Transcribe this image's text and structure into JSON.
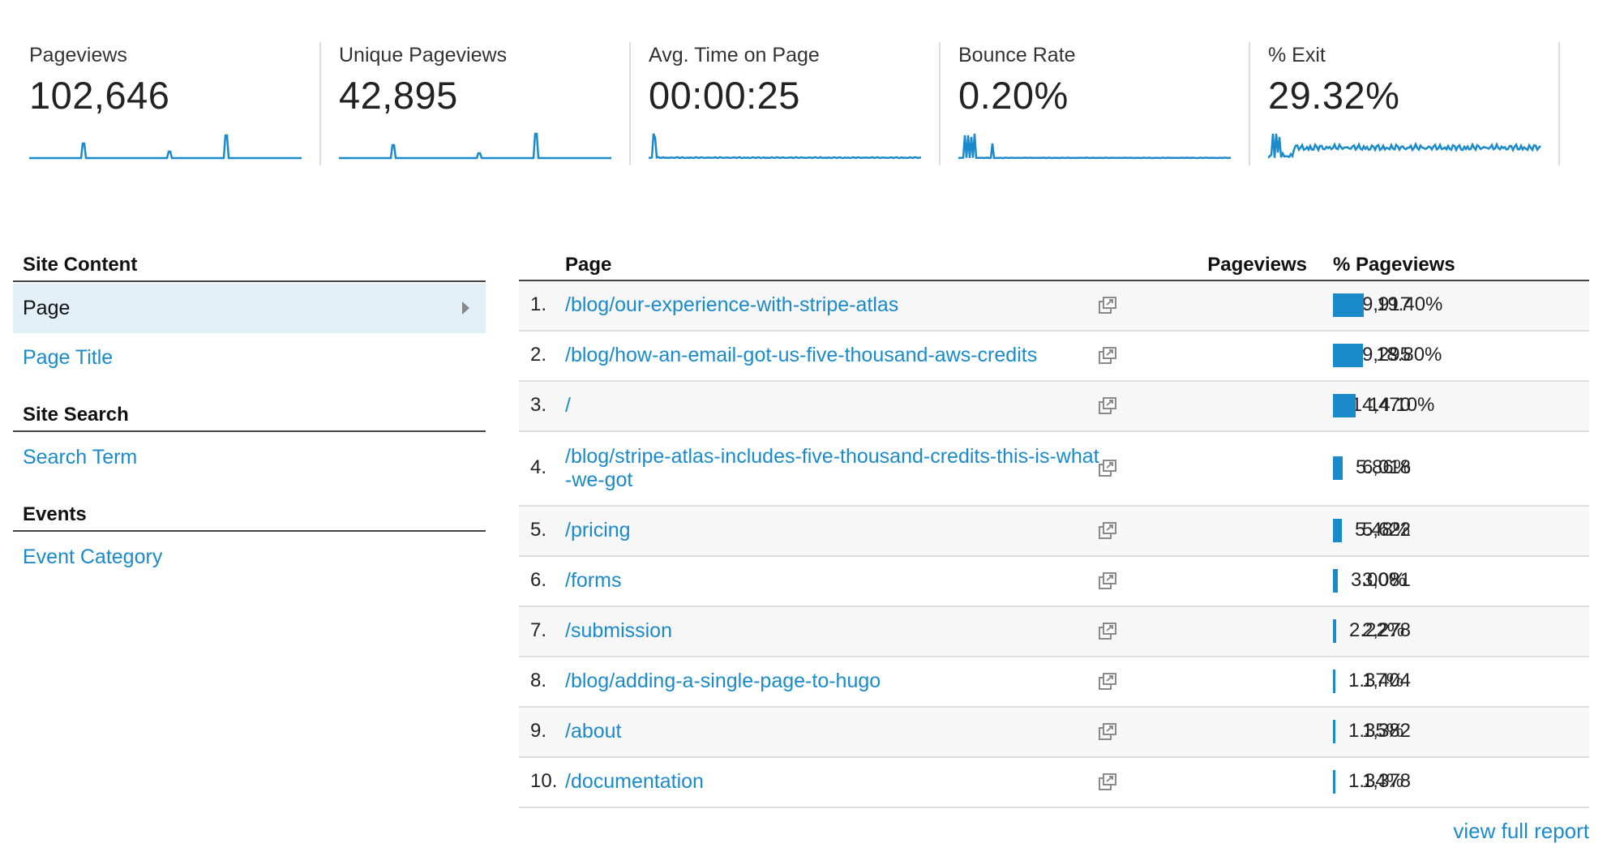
{
  "metrics": [
    {
      "label": "Pageviews",
      "value": "102,646"
    },
    {
      "label": "Unique Pageviews",
      "value": "42,895"
    },
    {
      "label": "Avg. Time on Page",
      "value": "00:00:25"
    },
    {
      "label": "Bounce Rate",
      "value": "0.20%"
    },
    {
      "label": "% Exit",
      "value": "29.32%"
    }
  ],
  "nav": {
    "site_content": {
      "heading": "Site Content",
      "selected": "Page",
      "link": "Page Title"
    },
    "site_search": {
      "heading": "Site Search",
      "link": "Search Term"
    },
    "events": {
      "heading": "Events",
      "link": "Event Category"
    }
  },
  "table": {
    "headers": {
      "page": "Page",
      "pageviews": "Pageviews",
      "pct": "% Pageviews"
    },
    "rows": [
      {
        "num": "1.",
        "page": "/blog/our-experience-with-stripe-atlas",
        "pageviews": "19,917",
        "pct": "19.40%",
        "share": 0.194
      },
      {
        "num": "2.",
        "page": "/blog/how-an-email-got-us-five-thousand-aws-credits",
        "pageviews": "19,295",
        "pct": "18.80%",
        "share": 0.188
      },
      {
        "num": "3.",
        "page": "/",
        "pageviews": "14,470",
        "pct": "14.10%",
        "share": 0.141
      },
      {
        "num": "4.",
        "page": "/blog/stripe-atlas-includes-five-thousand-credits-this-is-what-we-got",
        "pageviews": "6,018",
        "pct": "5.86%",
        "share": 0.0586
      },
      {
        "num": "5.",
        "page": "/pricing",
        "pageviews": "5,622",
        "pct": "5.48%",
        "share": 0.0548
      },
      {
        "num": "6.",
        "page": "/forms",
        "pageviews": "3,081",
        "pct": "3.00%",
        "share": 0.03
      },
      {
        "num": "7.",
        "page": "/submission",
        "pageviews": "2,278",
        "pct": "2.22%",
        "share": 0.0222
      },
      {
        "num": "8.",
        "page": "/blog/adding-a-single-page-to-hugo",
        "pageviews": "1,404",
        "pct": "1.37%",
        "share": 0.0137
      },
      {
        "num": "9.",
        "page": "/about",
        "pageviews": "1,382",
        "pct": "1.35%",
        "share": 0.0135
      },
      {
        "num": "10.",
        "page": "/documentation",
        "pageviews": "1,378",
        "pct": "1.34%",
        "share": 0.0134
      }
    ]
  },
  "footer": {
    "view_full_report": "view full report"
  },
  "colors": {
    "accent": "#1a8acb",
    "selected_bg": "#e3f0f7"
  },
  "icons": {
    "row_action": "open-in-new-window-icon",
    "nav_caret": "caret-right-icon"
  }
}
